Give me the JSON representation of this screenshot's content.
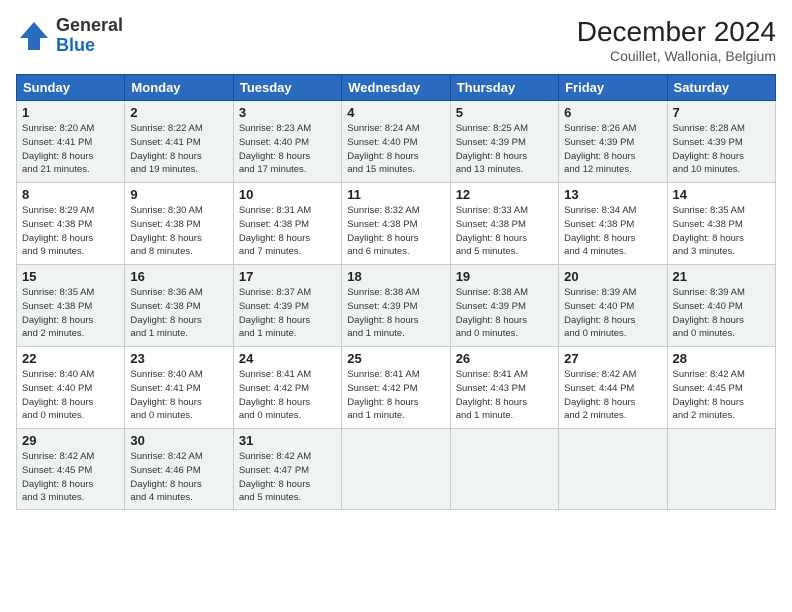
{
  "header": {
    "logo_general": "General",
    "logo_blue": "Blue",
    "title": "December 2024",
    "subtitle": "Couillet, Wallonia, Belgium"
  },
  "weekdays": [
    "Sunday",
    "Monday",
    "Tuesday",
    "Wednesday",
    "Thursday",
    "Friday",
    "Saturday"
  ],
  "weeks": [
    [
      {
        "day": "1",
        "info": "Sunrise: 8:20 AM\nSunset: 4:41 PM\nDaylight: 8 hours\nand 21 minutes."
      },
      {
        "day": "2",
        "info": "Sunrise: 8:22 AM\nSunset: 4:41 PM\nDaylight: 8 hours\nand 19 minutes."
      },
      {
        "day": "3",
        "info": "Sunrise: 8:23 AM\nSunset: 4:40 PM\nDaylight: 8 hours\nand 17 minutes."
      },
      {
        "day": "4",
        "info": "Sunrise: 8:24 AM\nSunset: 4:40 PM\nDaylight: 8 hours\nand 15 minutes."
      },
      {
        "day": "5",
        "info": "Sunrise: 8:25 AM\nSunset: 4:39 PM\nDaylight: 8 hours\nand 13 minutes."
      },
      {
        "day": "6",
        "info": "Sunrise: 8:26 AM\nSunset: 4:39 PM\nDaylight: 8 hours\nand 12 minutes."
      },
      {
        "day": "7",
        "info": "Sunrise: 8:28 AM\nSunset: 4:39 PM\nDaylight: 8 hours\nand 10 minutes."
      }
    ],
    [
      {
        "day": "8",
        "info": "Sunrise: 8:29 AM\nSunset: 4:38 PM\nDaylight: 8 hours\nand 9 minutes."
      },
      {
        "day": "9",
        "info": "Sunrise: 8:30 AM\nSunset: 4:38 PM\nDaylight: 8 hours\nand 8 minutes."
      },
      {
        "day": "10",
        "info": "Sunrise: 8:31 AM\nSunset: 4:38 PM\nDaylight: 8 hours\nand 7 minutes."
      },
      {
        "day": "11",
        "info": "Sunrise: 8:32 AM\nSunset: 4:38 PM\nDaylight: 8 hours\nand 6 minutes."
      },
      {
        "day": "12",
        "info": "Sunrise: 8:33 AM\nSunset: 4:38 PM\nDaylight: 8 hours\nand 5 minutes."
      },
      {
        "day": "13",
        "info": "Sunrise: 8:34 AM\nSunset: 4:38 PM\nDaylight: 8 hours\nand 4 minutes."
      },
      {
        "day": "14",
        "info": "Sunrise: 8:35 AM\nSunset: 4:38 PM\nDaylight: 8 hours\nand 3 minutes."
      }
    ],
    [
      {
        "day": "15",
        "info": "Sunrise: 8:35 AM\nSunset: 4:38 PM\nDaylight: 8 hours\nand 2 minutes."
      },
      {
        "day": "16",
        "info": "Sunrise: 8:36 AM\nSunset: 4:38 PM\nDaylight: 8 hours\nand 1 minute."
      },
      {
        "day": "17",
        "info": "Sunrise: 8:37 AM\nSunset: 4:39 PM\nDaylight: 8 hours\nand 1 minute."
      },
      {
        "day": "18",
        "info": "Sunrise: 8:38 AM\nSunset: 4:39 PM\nDaylight: 8 hours\nand 1 minute."
      },
      {
        "day": "19",
        "info": "Sunrise: 8:38 AM\nSunset: 4:39 PM\nDaylight: 8 hours\nand 0 minutes."
      },
      {
        "day": "20",
        "info": "Sunrise: 8:39 AM\nSunset: 4:40 PM\nDaylight: 8 hours\nand 0 minutes."
      },
      {
        "day": "21",
        "info": "Sunrise: 8:39 AM\nSunset: 4:40 PM\nDaylight: 8 hours\nand 0 minutes."
      }
    ],
    [
      {
        "day": "22",
        "info": "Sunrise: 8:40 AM\nSunset: 4:40 PM\nDaylight: 8 hours\nand 0 minutes."
      },
      {
        "day": "23",
        "info": "Sunrise: 8:40 AM\nSunset: 4:41 PM\nDaylight: 8 hours\nand 0 minutes."
      },
      {
        "day": "24",
        "info": "Sunrise: 8:41 AM\nSunset: 4:42 PM\nDaylight: 8 hours\nand 0 minutes."
      },
      {
        "day": "25",
        "info": "Sunrise: 8:41 AM\nSunset: 4:42 PM\nDaylight: 8 hours\nand 1 minute."
      },
      {
        "day": "26",
        "info": "Sunrise: 8:41 AM\nSunset: 4:43 PM\nDaylight: 8 hours\nand 1 minute."
      },
      {
        "day": "27",
        "info": "Sunrise: 8:42 AM\nSunset: 4:44 PM\nDaylight: 8 hours\nand 2 minutes."
      },
      {
        "day": "28",
        "info": "Sunrise: 8:42 AM\nSunset: 4:45 PM\nDaylight: 8 hours\nand 2 minutes."
      }
    ],
    [
      {
        "day": "29",
        "info": "Sunrise: 8:42 AM\nSunset: 4:45 PM\nDaylight: 8 hours\nand 3 minutes."
      },
      {
        "day": "30",
        "info": "Sunrise: 8:42 AM\nSunset: 4:46 PM\nDaylight: 8 hours\nand 4 minutes."
      },
      {
        "day": "31",
        "info": "Sunrise: 8:42 AM\nSunset: 4:47 PM\nDaylight: 8 hours\nand 5 minutes."
      },
      null,
      null,
      null,
      null
    ]
  ]
}
